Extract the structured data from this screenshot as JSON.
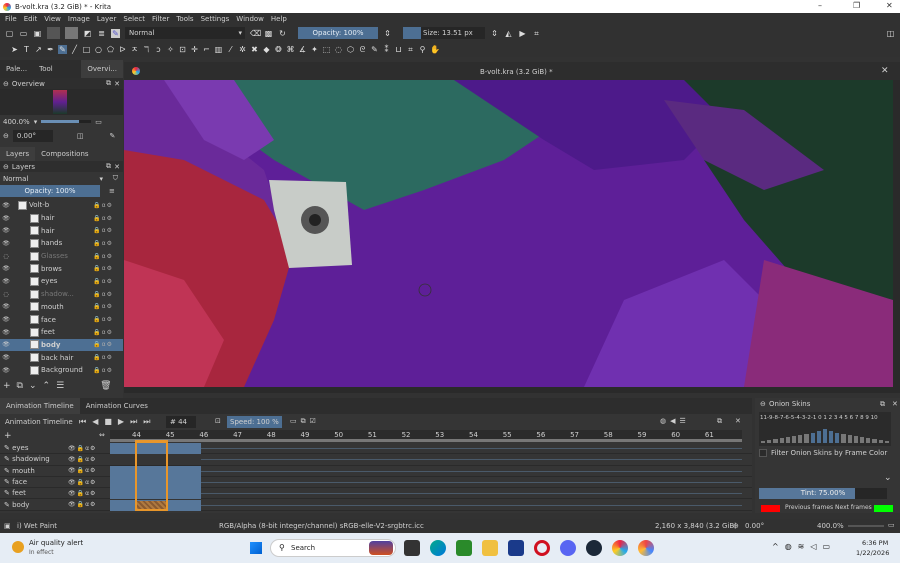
{
  "window": {
    "title": "B-volt.kra (3.2 GiB) * - Krita",
    "min": "–",
    "max": "❐",
    "close": "✕"
  },
  "menu": [
    "File",
    "Edit",
    "View",
    "Image",
    "Layer",
    "Select",
    "Filter",
    "Tools",
    "Settings",
    "Window",
    "Help"
  ],
  "toolbar": {
    "blend_mode": "Normal",
    "opacity": "Opacity: 100%",
    "size": "Size: 13.51 px"
  },
  "docker_tabs": [
    "Pale...",
    "Tool Optio...",
    "Overvi..."
  ],
  "overview": {
    "title": "Overview",
    "zoom": "400.0%",
    "rotation": "0.00°",
    "zoom_fill": 0.75
  },
  "layers_tabs": [
    "Layers",
    "Compositions"
  ],
  "layers": {
    "title": "Layers",
    "blend": "Normal",
    "opacity": "Opacity:  100%",
    "items": [
      {
        "name": "Volt-b",
        "visible": true,
        "group": true
      },
      {
        "name": "hair",
        "visible": true
      },
      {
        "name": "hair",
        "visible": true
      },
      {
        "name": "hands",
        "visible": true
      },
      {
        "name": "Glasses",
        "visible": false
      },
      {
        "name": "brows",
        "visible": true
      },
      {
        "name": "eyes",
        "visible": true
      },
      {
        "name": "shadow...",
        "visible": false
      },
      {
        "name": "mouth",
        "visible": true
      },
      {
        "name": "face",
        "visible": true
      },
      {
        "name": "feet",
        "visible": true
      },
      {
        "name": "body",
        "visible": true,
        "selected": true
      },
      {
        "name": "back hair",
        "visible": true
      },
      {
        "name": "Background",
        "visible": true
      }
    ]
  },
  "document": {
    "tab_title": "B-volt.kra (3.2 GiB) *"
  },
  "timeline": {
    "tabs": [
      "Animation Timeline",
      "Animation Curves"
    ],
    "title": "Animation Timeline",
    "frame": "44",
    "speed": "Speed: 100 %",
    "frames": [
      "44",
      "45",
      "46",
      "47",
      "48",
      "49",
      "50",
      "51",
      "52",
      "53",
      "54",
      "55",
      "56",
      "57",
      "58",
      "59",
      "60",
      "61"
    ],
    "rows": [
      "eyes",
      "shadowing",
      "mouth",
      "face",
      "feet",
      "body"
    ]
  },
  "onion": {
    "title": "Onion Skins",
    "numbers": "11-9-8-7-6-5-4-3-2-1  0  1 2 3 4 5 6 7 8 9 10",
    "filter": "Filter Onion Skins by Frame Color",
    "tint": "Tint: 75.00%",
    "tint_value": 0.75,
    "prev": "Previous frames",
    "next": "Next frames",
    "prev_color": "#ff0000",
    "next_color": "#00ff00"
  },
  "status": {
    "brush": "i) Wet Paint",
    "color": "RGB/Alpha (8-bit integer/channel)  sRGB-elle-V2-srgbtrc.icc",
    "dims": "2,160 x 3,840 (3.2 GiB)",
    "rotation": "0.00°",
    "zoom": "400.0%"
  },
  "taskbar": {
    "alert_title": "Air quality alert",
    "alert_sub": "In effect",
    "search": "Search",
    "time": "6:36 PM",
    "date": "1/22/2026"
  }
}
